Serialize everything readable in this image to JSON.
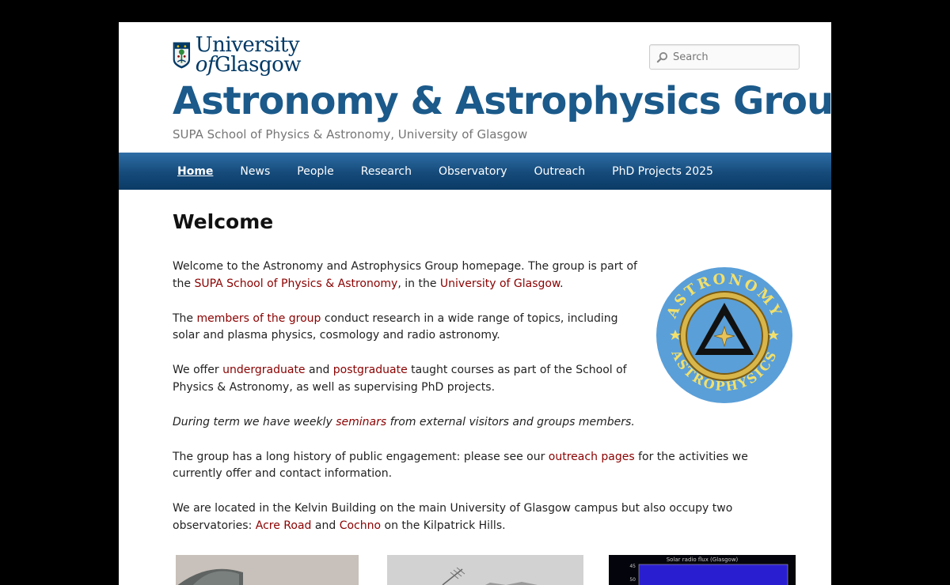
{
  "header": {
    "logo_line1": "University",
    "logo_line2_prefix": "of",
    "logo_line2_word": "Glasgow",
    "site_title": "Astronomy & Astrophysics Group",
    "site_description": "SUPA School of Physics & Astronomy, University of Glasgow",
    "search_placeholder": "Search"
  },
  "nav": {
    "items": [
      {
        "label": "Home",
        "active": true
      },
      {
        "label": "News"
      },
      {
        "label": "People"
      },
      {
        "label": "Research"
      },
      {
        "label": "Observatory"
      },
      {
        "label": "Outreach"
      },
      {
        "label": "PhD Projects 2025"
      }
    ]
  },
  "main": {
    "title": "Welcome",
    "p1": {
      "t1": "Welcome to the Astronomy and Astrophysics Group homepage. The group is part of the ",
      "link1": "SUPA School of Physics & Astronomy",
      "t2": ", in the ",
      "link2": "University of Glasgow",
      "t3": "."
    },
    "p2": {
      "t1": "The ",
      "link1": "members of the group",
      "t2": " conduct research in a wide range of topics, including solar and plasma physics, cosmology and radio astronomy."
    },
    "p3": {
      "t1": "We offer ",
      "link1": "undergraduate",
      "t2": " and ",
      "link2": "postgraduate",
      "t3": " taught courses as part of the School of Physics & Astronomy, as well as supervising PhD projects."
    },
    "p4": {
      "t1": "During term we have weekly ",
      "link1": "seminars",
      "t2": " from external visitors and groups members."
    },
    "p5": {
      "t1": "The group has a long history of public engagement: please see our ",
      "link1": "outreach pages",
      "t2": " for the activities we currently offer and contact information."
    },
    "p6": {
      "t1": "We are located in the Kelvin Building on the main University of Glasgow campus but also occupy two observatories: ",
      "link1": "Acre Road",
      "t2": " and ",
      "link2": "Cochno",
      "t3": " on the Kilpatrick Hills."
    },
    "badge_top": "ASTRONOMY",
    "badge_bottom": "ASTROPHYSICS",
    "chart_title": "Solar radio flux (Glasgow)",
    "chart_ticks": [
      "45",
      "50"
    ]
  },
  "colors": {
    "brand_blue": "#1b5a8a",
    "link": "#8b0000",
    "nav": "#154a7a"
  }
}
